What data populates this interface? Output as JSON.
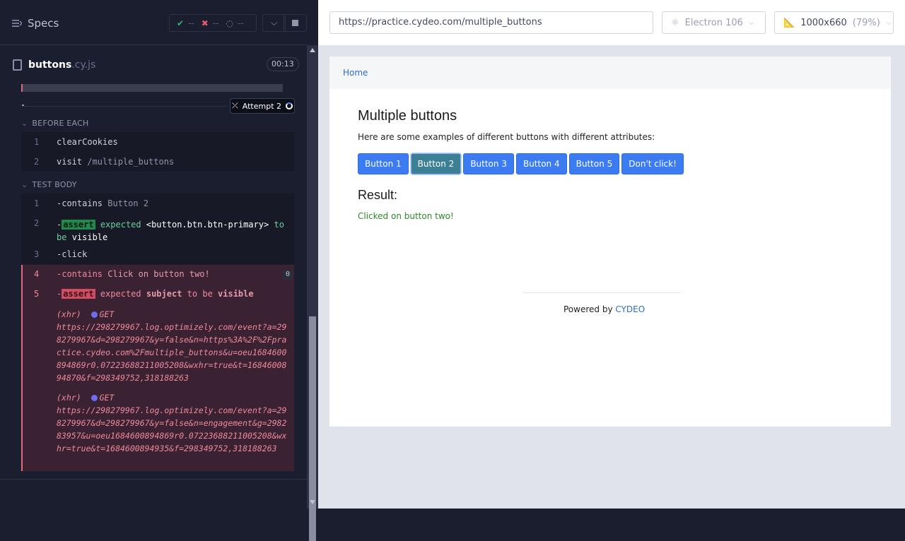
{
  "runner": {
    "specs_label": "Specs",
    "stats": {
      "passed": "--",
      "failed": "--",
      "pending": "--"
    },
    "file": {
      "name": "buttons",
      "ext": ".cy.js",
      "timer": "00:13"
    },
    "attempt_label": "Attempt 2",
    "sections": {
      "before_each": "BEFORE EACH",
      "test_body": "TEST BODY"
    },
    "before_each_cmds": [
      {
        "num": "1",
        "name": "clearCookies",
        "arg": ""
      },
      {
        "num": "2",
        "name": "visit",
        "arg": "/multiple_buttons"
      }
    ],
    "test_body_cmds": [
      {
        "num": "1",
        "name": "-contains",
        "arg": "Button 2"
      },
      {
        "num": "2",
        "prefix": "-",
        "badge": "assert",
        "text1": "expected",
        "text2": "<button.btn.btn-primary>",
        "text3": "to",
        "text4": "be",
        "text5": "visible"
      },
      {
        "num": "3",
        "name": "-click",
        "arg": ""
      }
    ],
    "failed_cmds": {
      "line4": {
        "num": "4",
        "name": "-contains",
        "arg": "Click on button two!",
        "count": "0"
      },
      "line5": {
        "num": "5",
        "prefix": "-",
        "badge": "assert",
        "text1": "expected",
        "text2": "subject",
        "text3": "to be",
        "text4": "visible"
      },
      "xhr1": {
        "tag": "(xhr)",
        "method": "GET",
        "url": "https://298279967.log.optimizely.com/event?a=298279967&d=298279967&y=false&n=https%3A%2F%2Fpractice.cydeo.com%2Fmultiple_buttons&u=oeu1684600894869r0.07223688211005208&wxhr=true&t=1684600894870&f=298349752,318188263"
      },
      "xhr2": {
        "tag": "(xhr)",
        "method": "GET",
        "url": "https://298279967.log.optimizely.com/event?a=298279967&d=298279967&y=false&n=engagement&g=298283957&u=oeu1684600894869r0.07223688211005208&wxhr=true&t=1684600894935&f=298349752,318188263"
      }
    }
  },
  "aut": {
    "url": "https://practice.cydeo.com/multiple_buttons",
    "browser": "Electron 106",
    "viewport": "1000x660",
    "zoom": "(79%)",
    "breadcrumb": "Home",
    "heading": "Multiple buttons",
    "description": "Here are some examples of different buttons with different attributes:",
    "buttons": [
      "Button 1",
      "Button 2",
      "Button 3",
      "Button 4",
      "Button 5",
      "Don't click!"
    ],
    "result_heading": "Result:",
    "result_text": "Clicked on button two!",
    "footer_prefix": "Powered by",
    "footer_link": "CYDEO"
  },
  "colors": {
    "accent": "#3c7cf2",
    "active_button": "#3d8095",
    "success": "#2a8a2a",
    "fail": "#e06b7a"
  }
}
